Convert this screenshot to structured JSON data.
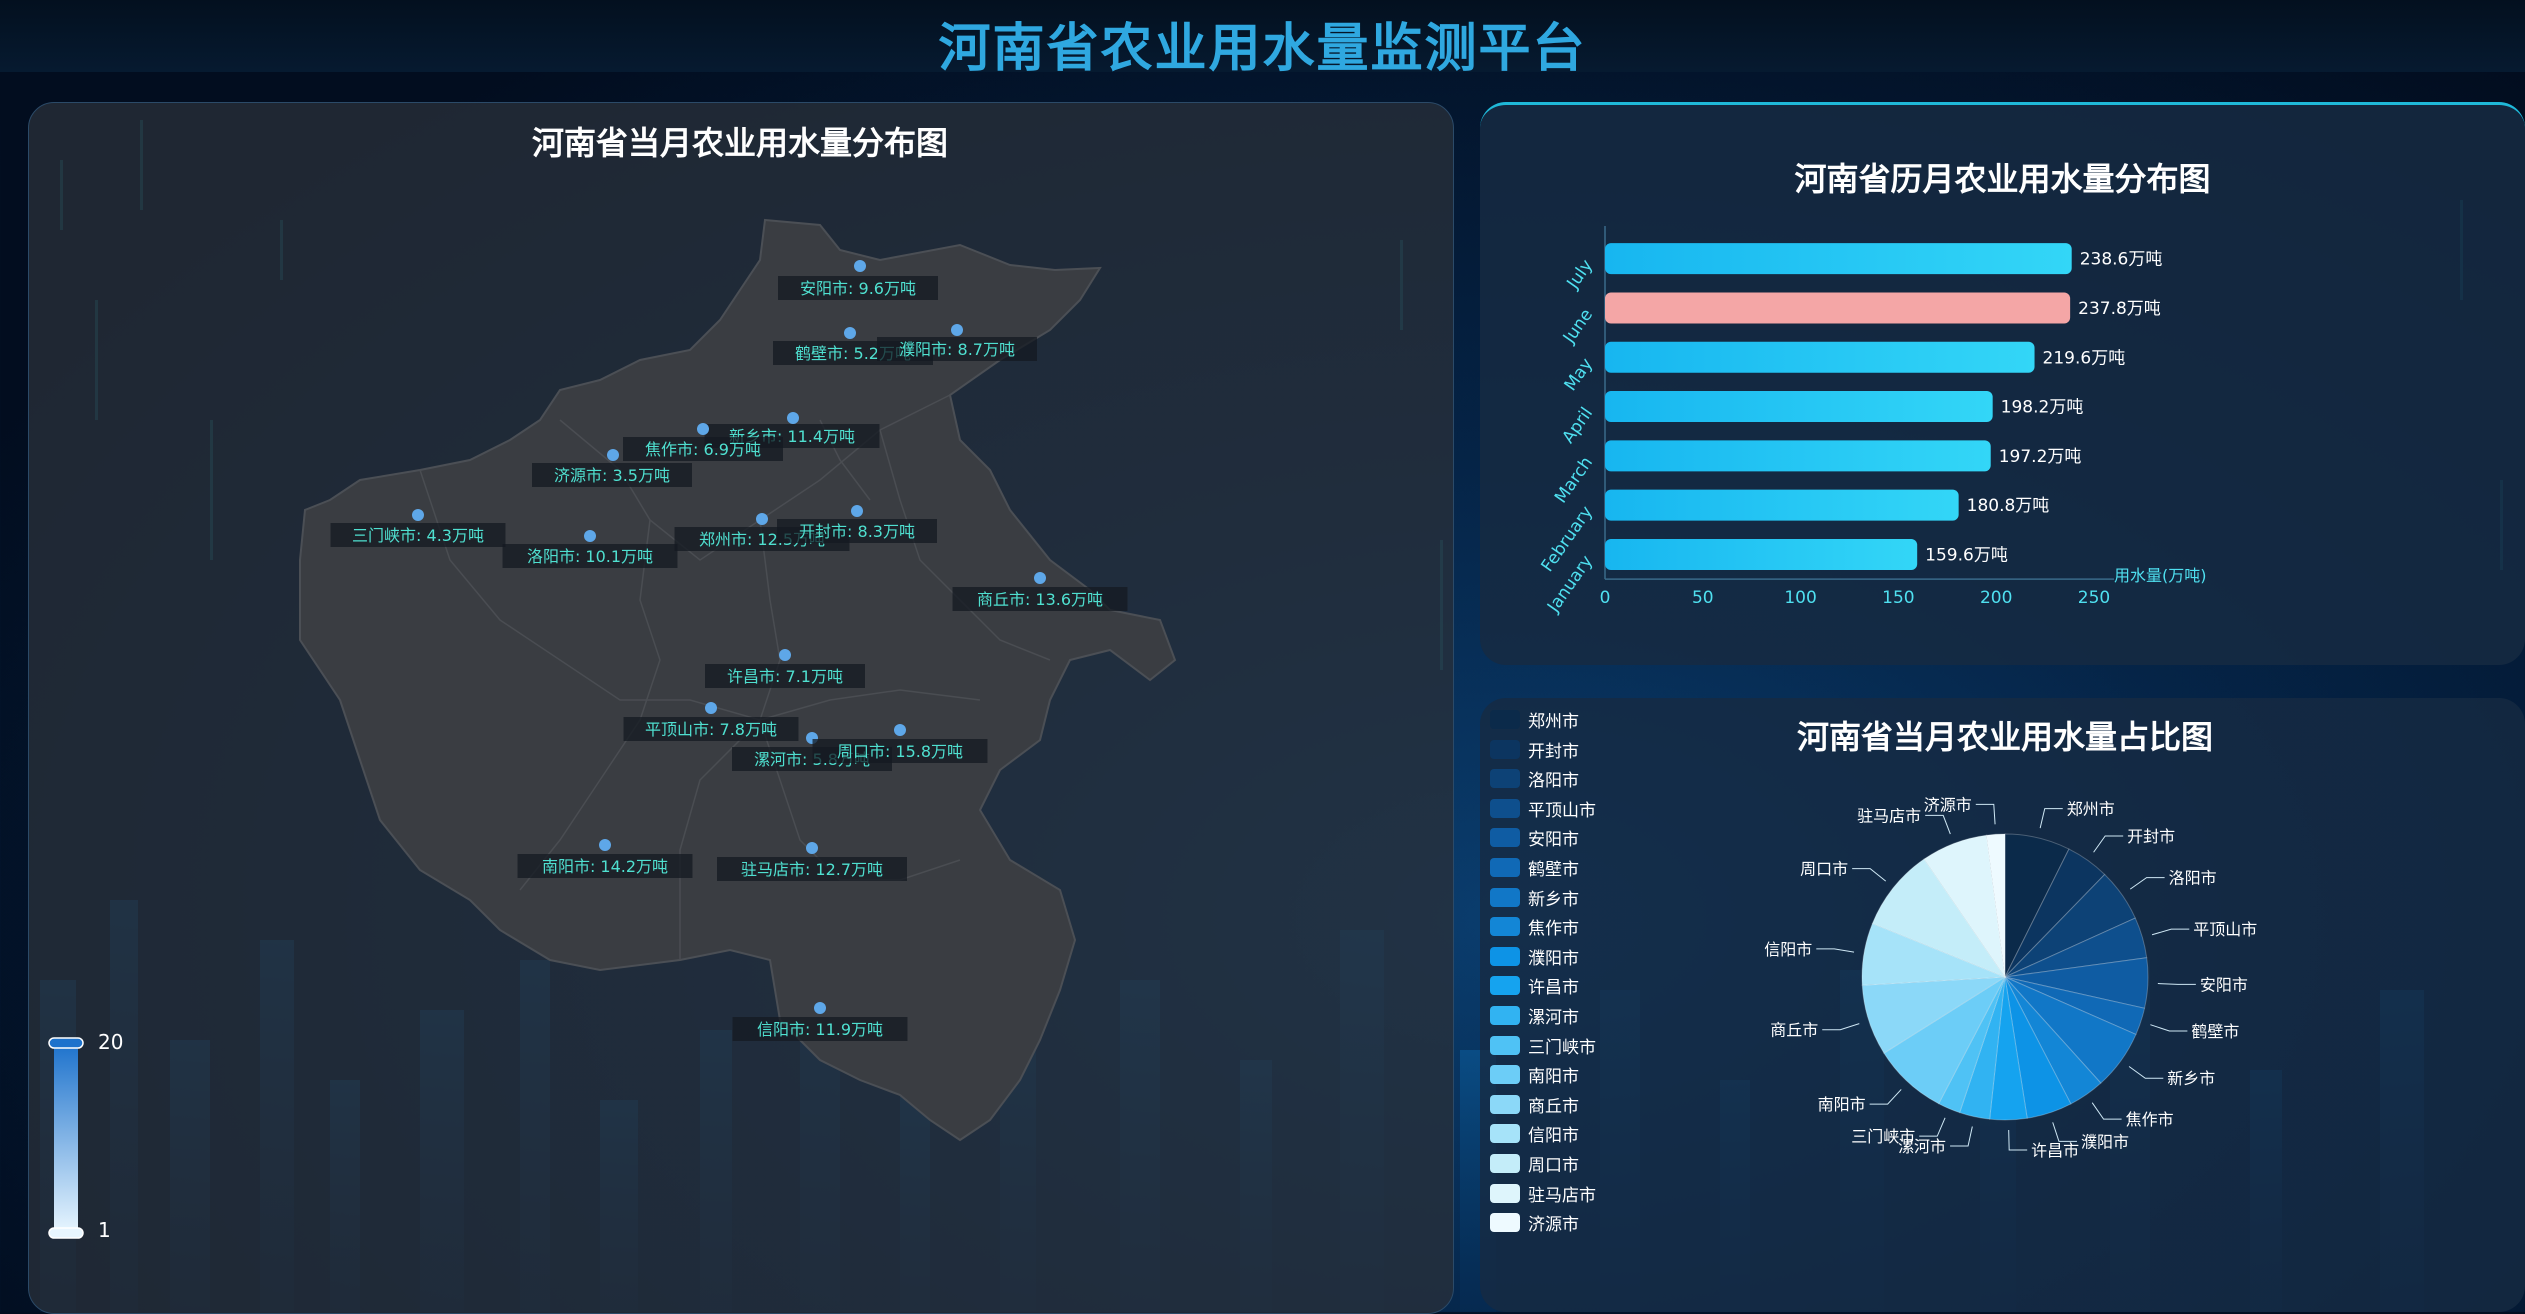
{
  "header": {
    "title": "河南省农业用水量监测平台"
  },
  "map": {
    "title": "河南省当月农业用水量分布图",
    "visual_map": {
      "max_label": "20",
      "min_label": "1"
    },
    "cities": [
      {
        "name": "安阳市",
        "value": 9.6,
        "label": "安阳市: 9.6万吨"
      },
      {
        "name": "鹤壁市",
        "value": 5.2,
        "label": "鹤壁市: 5.2万吨"
      },
      {
        "name": "濮阳市",
        "value": 8.7,
        "label": "濮阳市: 8.7万吨"
      },
      {
        "name": "新乡市",
        "value": 11.4,
        "label": "新乡市: 11.4万吨"
      },
      {
        "name": "焦作市",
        "value": 6.9,
        "label": "焦作市: 6.9万吨"
      },
      {
        "name": "济源市",
        "value": 3.5,
        "label": "济源市: 3.5万吨"
      },
      {
        "name": "三门峡市",
        "value": 4.3,
        "label": "三门峡市: 4.3万吨"
      },
      {
        "name": "洛阳市",
        "value": 10.1,
        "label": "洛阳市: 10.1万吨"
      },
      {
        "name": "郑州市",
        "value": 12.5,
        "label": "郑州市: 12.5万吨"
      },
      {
        "name": "开封市",
        "value": 8.3,
        "label": "开封市: 8.3万吨"
      },
      {
        "name": "商丘市",
        "value": 13.6,
        "label": "商丘市: 13.6万吨"
      },
      {
        "name": "许昌市",
        "value": 7.1,
        "label": "许昌市: 7.1万吨"
      },
      {
        "name": "平顶山市",
        "value": 7.8,
        "label": "平顶山市: 7.8万吨"
      },
      {
        "name": "漯河市",
        "value": 5.8,
        "label": "漯河市: 5.8万吨"
      },
      {
        "name": "周口市",
        "value": 15.8,
        "label": "周口市: 15.8万吨"
      },
      {
        "name": "南阳市",
        "value": 14.2,
        "label": "南阳市: 14.2万吨"
      },
      {
        "name": "驻马店市",
        "value": 12.7,
        "label": "驻马店市: 12.7万吨"
      },
      {
        "name": "信阳市",
        "value": 11.9,
        "label": "信阳市: 11.9万吨"
      }
    ]
  },
  "bar": {
    "title": "河南省历月农业用水量分布图",
    "chart_data": {
      "type": "bar",
      "orientation": "horizontal",
      "categories": [
        "January",
        "February",
        "March",
        "April",
        "May",
        "June",
        "July"
      ],
      "values": [
        159.6,
        180.8,
        197.2,
        198.2,
        219.6,
        237.8,
        238.6
      ],
      "value_labels": [
        "159.6万吨",
        "180.8万吨",
        "197.2万吨",
        "198.2万吨",
        "219.6万吨",
        "237.8万吨",
        "238.6万吨"
      ],
      "highlight_category": "June",
      "xlim": [
        0,
        250
      ],
      "xticks": [
        "0",
        "50",
        "100",
        "150",
        "200",
        "250"
      ],
      "xlabel": "用水量(万吨)",
      "colors": {
        "bar": "#1ec8f5",
        "highlight": "#f4a6a6"
      }
    }
  },
  "pie": {
    "title": "河南省当月农业用水量占比图",
    "chart_data": {
      "type": "pie",
      "labels": [
        "郑州市",
        "开封市",
        "洛阳市",
        "平顶山市",
        "安阳市",
        "鹤壁市",
        "新乡市",
        "焦作市",
        "濮阳市",
        "许昌市",
        "漯河市",
        "三门峡市",
        "南阳市",
        "商丘市",
        "信阳市",
        "周口市",
        "驻马店市",
        "济源市"
      ],
      "values": [
        12.5,
        8.3,
        10.1,
        7.8,
        9.6,
        5.2,
        11.4,
        6.9,
        8.7,
        7.1,
        5.8,
        4.3,
        14.2,
        13.6,
        11.9,
        15.8,
        12.7,
        3.5
      ],
      "colors": [
        "#0b2a4a",
        "#0c3560",
        "#0d4276",
        "#0e4f8d",
        "#0f5ca3",
        "#1069b6",
        "#1177c7",
        "#1386d6",
        "#0d93e6",
        "#15a3ef",
        "#31b3f2",
        "#4fc2f5",
        "#6ccdf7",
        "#8bd8f8",
        "#a6e3f9",
        "#c4edf9",
        "#def5fc",
        "#eefaff"
      ],
      "legend_position": "left"
    }
  }
}
